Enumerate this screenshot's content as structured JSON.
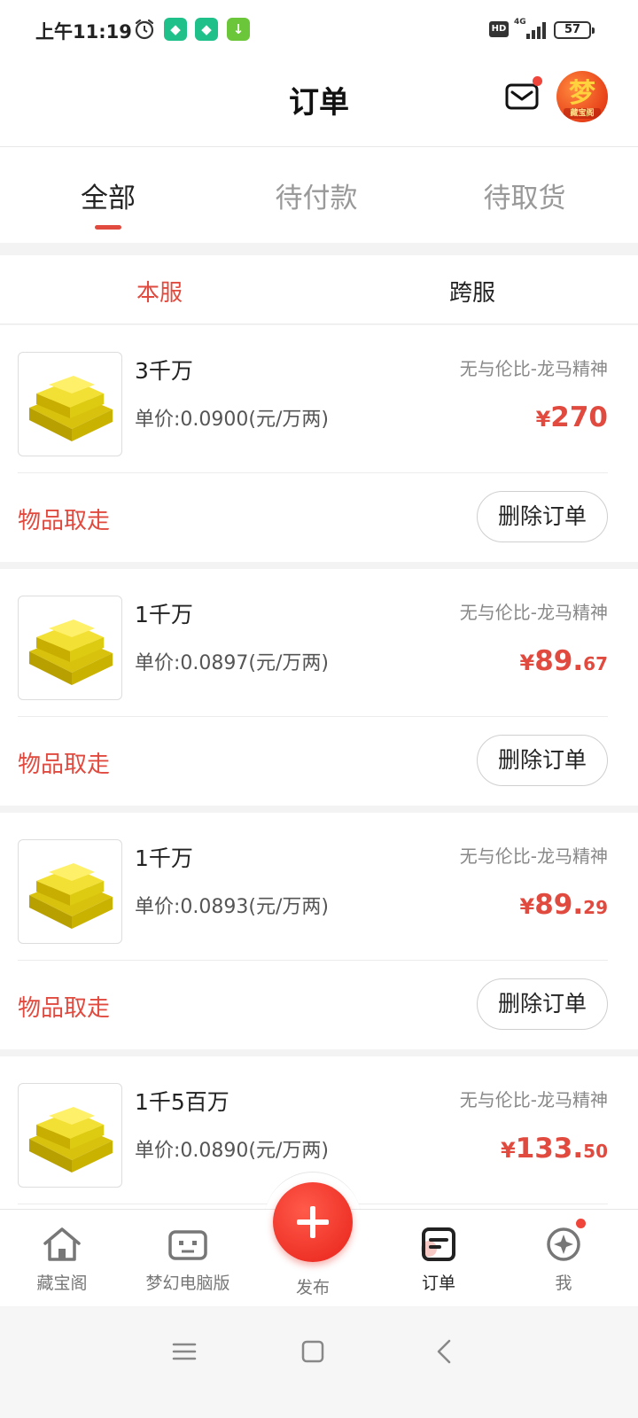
{
  "status_bar": {
    "time": "上午11:19",
    "hd": "HD",
    "network": "4G",
    "battery": "57"
  },
  "header": {
    "title": "订单",
    "avatar_text": "梦",
    "avatar_sub": "藏宝阁"
  },
  "tabs": [
    {
      "label": "全部",
      "active": true
    },
    {
      "label": "待付款",
      "active": false
    },
    {
      "label": "待取货",
      "active": false
    }
  ],
  "subtabs": [
    {
      "label": "本服",
      "active": true
    },
    {
      "label": "跨服",
      "active": false
    }
  ],
  "orders": [
    {
      "name": "3千万",
      "server": "无与伦比-龙马精神",
      "unit_price": "单价:0.0900(元/万两)",
      "currency": "¥",
      "price_int": "270",
      "price_dec": "",
      "status": "物品取走",
      "action": "删除订单"
    },
    {
      "name": "1千万",
      "server": "无与伦比-龙马精神",
      "unit_price": "单价:0.0897(元/万两)",
      "currency": "¥",
      "price_int": "89.",
      "price_dec": "67",
      "status": "物品取走",
      "action": "删除订单"
    },
    {
      "name": "1千万",
      "server": "无与伦比-龙马精神",
      "unit_price": "单价:0.0893(元/万两)",
      "currency": "¥",
      "price_int": "89.",
      "price_dec": "29",
      "status": "物品取走",
      "action": "删除订单"
    },
    {
      "name": "1千5百万",
      "server": "无与伦比-龙马精神",
      "unit_price": "单价:0.0890(元/万两)",
      "currency": "¥",
      "price_int": "133.",
      "price_dec": "50",
      "status": "",
      "action": ""
    }
  ],
  "bottom_nav": {
    "home": "藏宝阁",
    "pc": "梦幻电脑版",
    "publish": "发布",
    "orders": "订单",
    "me": "我"
  },
  "colors": {
    "accent": "#e04a3f",
    "gold": "#e8d21a"
  },
  "icons": [
    "alarm-icon",
    "mail-icon",
    "home-icon",
    "gamepad-icon",
    "plus-icon",
    "orders-icon",
    "compass-icon",
    "menu-icon",
    "square-icon",
    "back-icon"
  ]
}
